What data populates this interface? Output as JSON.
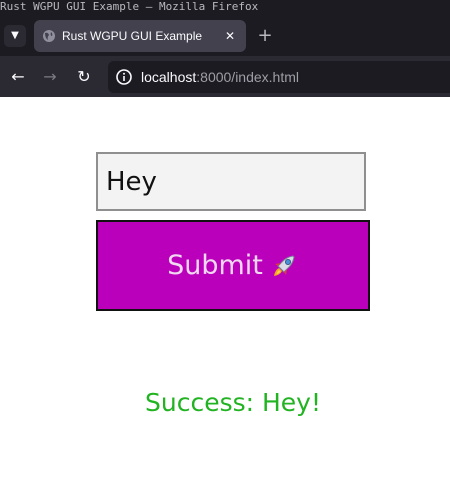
{
  "window": {
    "title": "Rust WGPU GUI Example — Mozilla Firefox"
  },
  "tabs": [
    {
      "title": "Rust WGPU GUI Example",
      "active": true,
      "icon": "globe-icon"
    }
  ],
  "toolbar": {
    "url_host": "localhost",
    "url_rest": ":8000/index.html",
    "icons": [
      "back-arrow-icon",
      "forward-arrow-icon",
      "reload-icon",
      "site-info-icon"
    ]
  },
  "form": {
    "input_value": "Hey",
    "submit_label": "Submit",
    "submit_icon": "rocket-icon",
    "submit_color": "#bb00bb",
    "status_text": "Success: Hey!",
    "status_color": "#22b322"
  }
}
